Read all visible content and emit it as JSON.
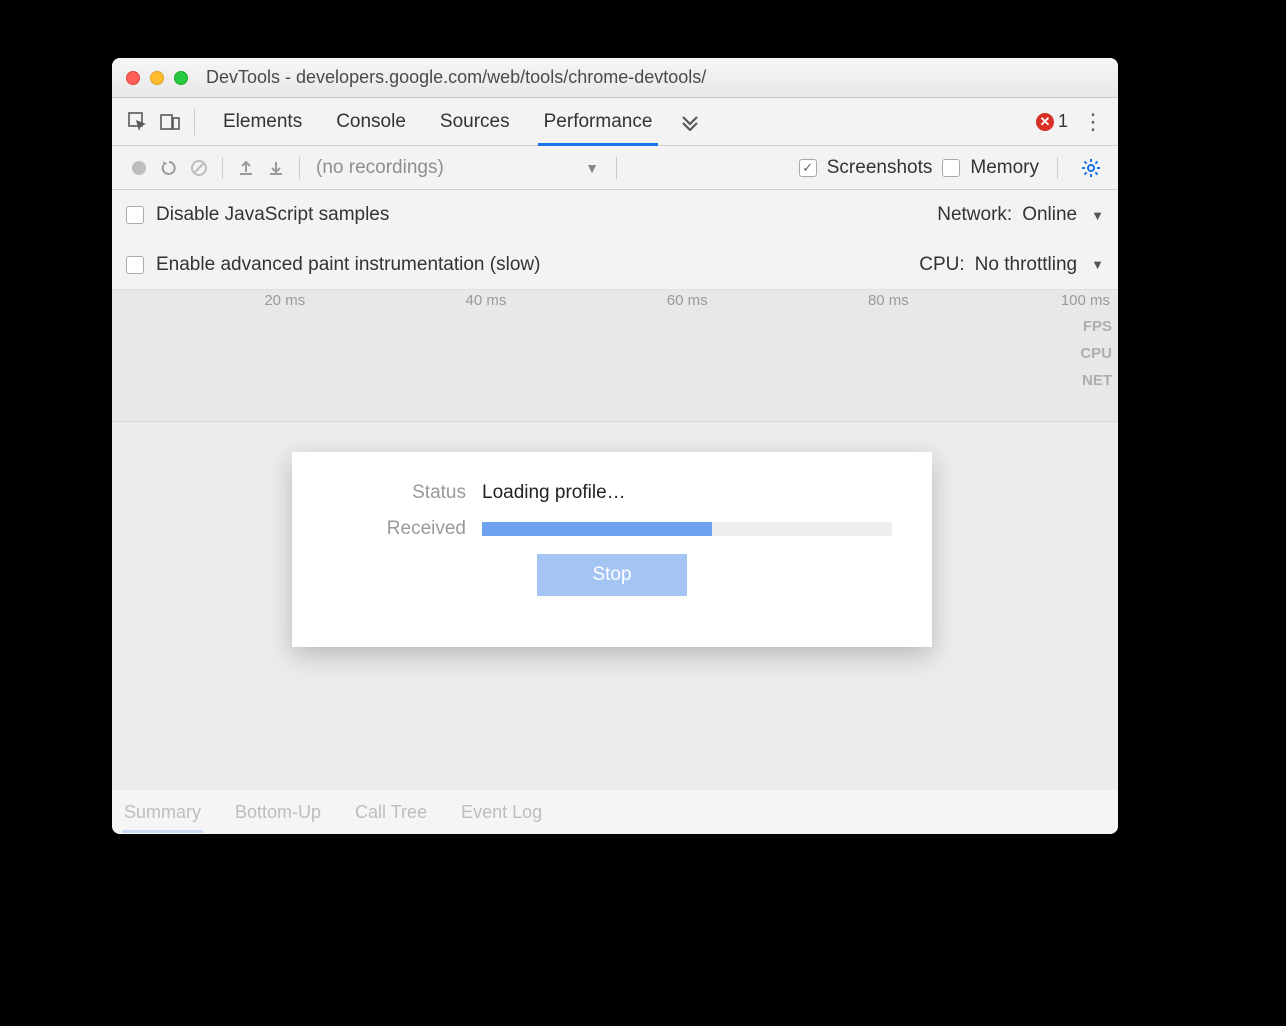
{
  "window": {
    "title": "DevTools - developers.google.com/web/tools/chrome-devtools/"
  },
  "tabs": {
    "items": [
      "Elements",
      "Console",
      "Sources",
      "Performance"
    ],
    "active": "Performance",
    "error_count": "1"
  },
  "toolbar": {
    "recordings_placeholder": "(no recordings)",
    "screenshots_label": "Screenshots",
    "memory_label": "Memory",
    "screenshots_checked": true,
    "memory_checked": false
  },
  "settings": {
    "disable_js_label": "Disable JavaScript samples",
    "enable_paint_label": "Enable advanced paint instrumentation (slow)",
    "network_label": "Network:",
    "network_value": "Online",
    "cpu_label": "CPU:",
    "cpu_value": "No throttling"
  },
  "timeline": {
    "ticks": [
      "20 ms",
      "40 ms",
      "60 ms",
      "80 ms",
      "100 ms"
    ],
    "tracks": [
      "FPS",
      "CPU",
      "NET"
    ]
  },
  "dialog": {
    "status_label": "Status",
    "status_value": "Loading profile…",
    "received_label": "Received",
    "progress_percent": 56,
    "stop_label": "Stop"
  },
  "bottom_tabs": {
    "items": [
      "Summary",
      "Bottom-Up",
      "Call Tree",
      "Event Log"
    ],
    "active": "Summary"
  }
}
